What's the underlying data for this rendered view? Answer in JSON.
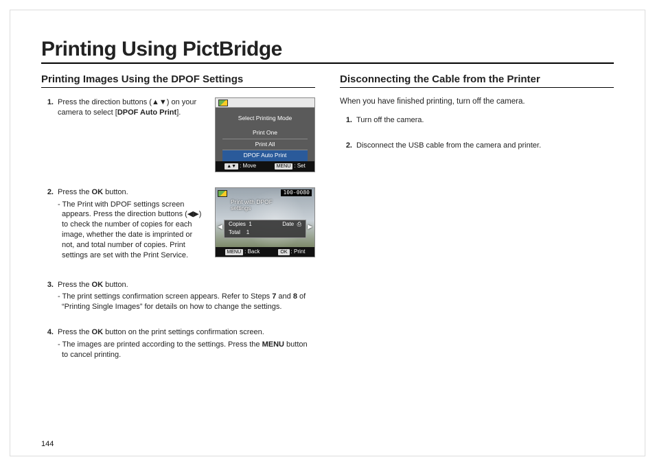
{
  "page": {
    "title": "Printing Using PictBridge",
    "number": "144"
  },
  "left": {
    "heading": "Printing Images Using the DPOF Settings",
    "steps": [
      {
        "n": "1.",
        "main_pre": "Press the direction buttons (▲▼) on your camera to select [",
        "bold": "DPOF Auto Print",
        "main_post": "]."
      },
      {
        "n": "2.",
        "main_pre": "Press the ",
        "bold": "OK",
        "main_post": " button.",
        "sub": "The Print with DPOF settings screen appears. Press the direction buttons (◀▶) to check the number of copies for each image, whether the date is imprinted or not, and total number of copies. Print settings are set with the Print Service."
      },
      {
        "n": "3.",
        "main_pre": "Press the ",
        "bold": "OK",
        "main_post": " button.",
        "sub_pre": "The print settings confirmation screen appears. Refer to Steps ",
        "sub_b1": "7",
        "sub_mid": " and ",
        "sub_b2": "8",
        "sub_post": " of “Printing Single Images” for details on how to change the settings."
      },
      {
        "n": "4.",
        "main_pre": "Press the ",
        "bold": "OK",
        "main_post": " button on the print settings confirmation screen.",
        "sub_pre": "The images are printed according to the settings. Press the ",
        "sub_b1": "MENU",
        "sub_post": " button to cancel printing."
      }
    ]
  },
  "right": {
    "heading": "Disconnecting the Cable from the Printer",
    "intro": "When you have finished printing, turn off the camera.",
    "steps": [
      {
        "n": "1.",
        "text": "Turn off the camera."
      },
      {
        "n": "2.",
        "text": "Disconnect the USB cable from the camera and printer."
      }
    ]
  },
  "lcd1": {
    "title": "Select Printing Mode",
    "opt1": "Print One",
    "opt2": "Print All",
    "opt3": "DPOF Auto Print",
    "bar_left_tag": "▲▼",
    "bar_left": ": Move",
    "bar_right_tag": "MENU",
    "bar_right": ": Set"
  },
  "lcd2": {
    "counter": "100-0080",
    "label_l1": "Print  with DPOF",
    "label_l2": "settings",
    "r1k": "Copies",
    "r1v": "1",
    "r1k2": "Date",
    "r1v2": "⎙",
    "r2k": "Total",
    "r2v": "1",
    "bar_left_tag": "MENU",
    "bar_left": ": Back",
    "bar_right_tag": "OK",
    "bar_right": ": Print"
  }
}
